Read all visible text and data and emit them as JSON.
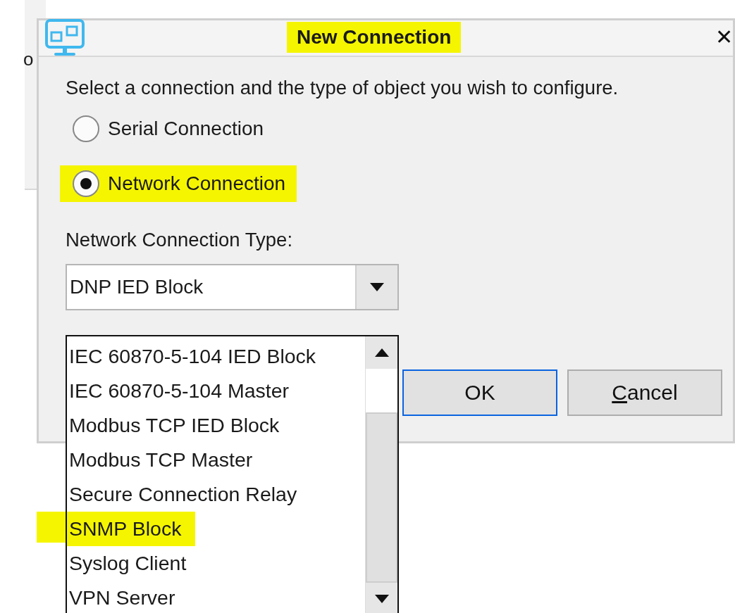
{
  "background_text": "o",
  "window": {
    "title": "New Connection",
    "title_highlighted": true,
    "close": "✕"
  },
  "prompt": "Select a connection and the type of object you wish to configure.",
  "radios": [
    {
      "label": "Serial Connection",
      "selected": false,
      "highlighted": false
    },
    {
      "label": "Network Connection",
      "selected": true,
      "highlighted": true
    }
  ],
  "type_label": "Network Connection Type:",
  "combo": {
    "value": "DNP IED Block",
    "expanded": true
  },
  "options": [
    {
      "label": "IEC 60870-5-104 IED Block",
      "highlighted": false
    },
    {
      "label": "IEC 60870-5-104 Master",
      "highlighted": false
    },
    {
      "label": "Modbus TCP IED Block",
      "highlighted": false
    },
    {
      "label": "Modbus TCP Master",
      "highlighted": false
    },
    {
      "label": "Secure Connection Relay",
      "highlighted": false
    },
    {
      "label": "SNMP Block",
      "highlighted": true
    },
    {
      "label": "Syslog Client",
      "highlighted": false
    },
    {
      "label": "VPN Server",
      "highlighted": false
    }
  ],
  "buttons": [
    {
      "label": "OK",
      "default": true
    },
    {
      "label": "ancel",
      "mnemonic": "C",
      "default": false
    }
  ]
}
